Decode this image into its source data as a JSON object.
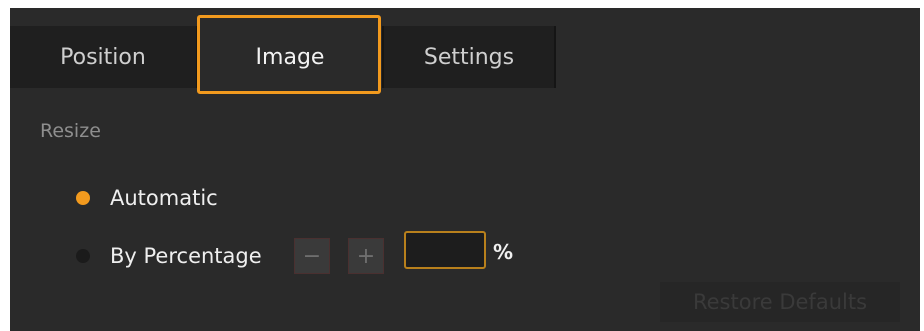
{
  "tabs": [
    {
      "label": "Position"
    },
    {
      "label": "Image"
    },
    {
      "label": "Settings"
    }
  ],
  "resize": {
    "section_label": "Resize",
    "options": [
      {
        "label": "Automatic",
        "selected": true
      },
      {
        "label": "By Percentage",
        "selected": false
      }
    ],
    "minus_symbol": "−",
    "plus_symbol": "+",
    "percentage_value": "",
    "percent_symbol": "%"
  },
  "restore_button": {
    "label": "Restore Defaults"
  },
  "colors": {
    "accent": "#f29a1e",
    "panel_bg": "#2a2a2a",
    "tab_bg": "#1f1f1f"
  }
}
